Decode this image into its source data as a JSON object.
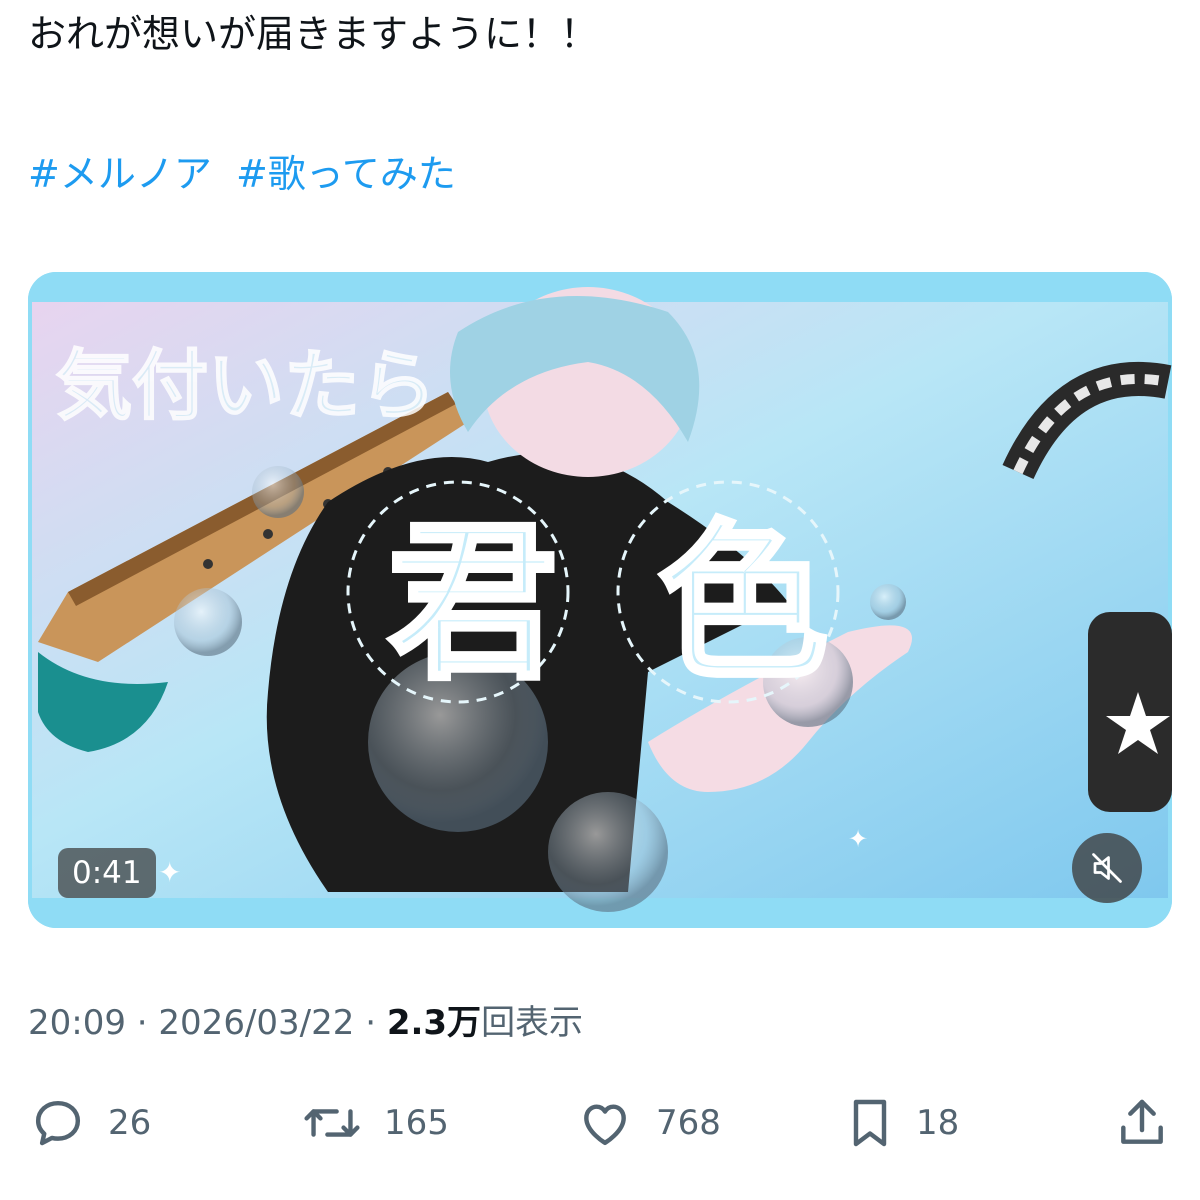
{
  "tweet": {
    "text": "おれが想いが届きますように！！",
    "hashtags": [
      "#メルノア",
      "#歌ってみた"
    ],
    "media": {
      "title_small": "気付いたら",
      "title_big_1": "君",
      "title_big_2": "色",
      "duration": "0:41",
      "mute_icon": "speaker-muted-icon"
    },
    "meta": {
      "time": "20:09",
      "separator": "·",
      "date": "2026/03/22",
      "views_count": "2.3万",
      "views_label": "回表示"
    },
    "actions": {
      "replies": "26",
      "retweets": "165",
      "likes": "768",
      "bookmarks": "18"
    },
    "colors": {
      "hashtag": "#1d9bf0",
      "secondary_text": "#536471",
      "primary_text": "#0f1419",
      "icon": "#536471"
    }
  }
}
